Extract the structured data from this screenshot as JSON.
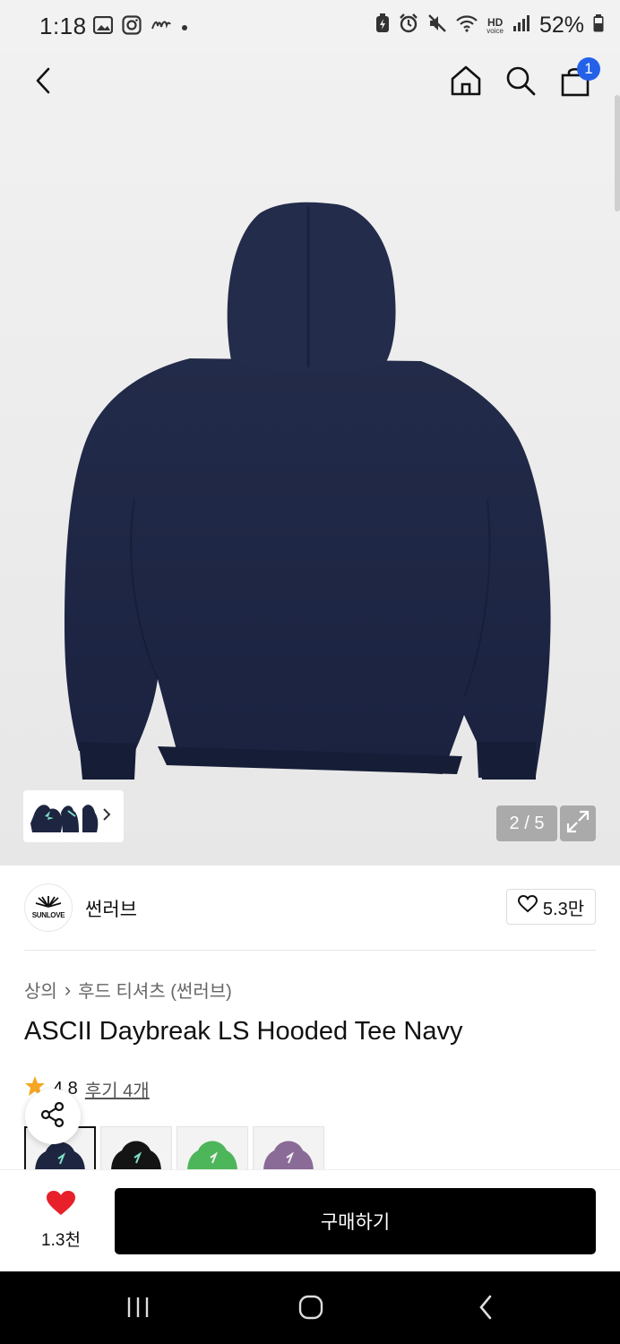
{
  "status_bar": {
    "time": "1:18",
    "battery": "52%",
    "hd_label": "HD",
    "voice_label": "voice"
  },
  "header": {
    "cart_count": "1"
  },
  "gallery": {
    "counter": "2 / 5",
    "product_color": "#1d2541"
  },
  "brand": {
    "name": "썬러브",
    "logo_text": "SUNLOVE",
    "likes": "5.3만"
  },
  "breadcrumb": {
    "category": "상의",
    "separator": "›",
    "subcategory": "후드 티셔츠 (썬러브)"
  },
  "product": {
    "title": "ASCII Daybreak LS Hooded Tee Navy",
    "rating": "4.8",
    "reviews": "후기 4개"
  },
  "swatches": [
    {
      "color": "#1d2541"
    },
    {
      "color": "#141414"
    },
    {
      "color": "#4db55a"
    },
    {
      "color": "#8a6a97"
    }
  ],
  "bottom_bar": {
    "wish_count": "1.3천",
    "buy_label": "구매하기"
  }
}
